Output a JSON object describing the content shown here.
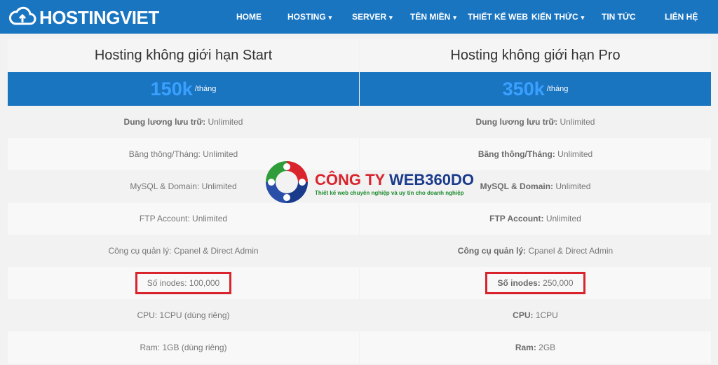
{
  "brand": {
    "name": "HOSTINGVIET"
  },
  "nav": {
    "items": [
      {
        "label": "HOME",
        "dropdown": false
      },
      {
        "label": "HOSTING",
        "dropdown": true
      },
      {
        "label": "SERVER",
        "dropdown": true
      },
      {
        "label": "TÊN MIỀN",
        "dropdown": true
      },
      {
        "label": "THIẾT KẾ WEB",
        "dropdown": false
      },
      {
        "label": "KIẾN THỨC",
        "dropdown": true
      },
      {
        "label": "TIN TỨC",
        "dropdown": false
      },
      {
        "label": "LIÊN HỆ",
        "dropdown": false
      }
    ],
    "caret": "▾"
  },
  "plans": [
    {
      "title": "Hosting không giới hạn Start",
      "price": "150k",
      "per": "/tháng",
      "features": [
        {
          "label": "Dung lương lưu trữ:",
          "value": " Unlimited",
          "bold": true
        },
        {
          "label": "Băng thông/Tháng:",
          "value": " Unlimited",
          "bold": false
        },
        {
          "label": "MySQL & Domain:",
          "value": " Unlimited",
          "bold": false
        },
        {
          "label": "FTP Account:",
          "value": " Unlimited",
          "bold": false
        },
        {
          "label": "Công cụ quản lý:",
          "value": " Cpanel & Direct Admin",
          "bold": false
        },
        {
          "label": "Số inodes:",
          "value": " 100,000",
          "bold": false
        },
        {
          "label": "CPU:",
          "value": " 1CPU (dùng riêng)",
          "bold": false
        },
        {
          "label": "Ram:",
          "value": " 1GB (dùng riêng)",
          "bold": false
        }
      ]
    },
    {
      "title": "Hosting không giới hạn Pro",
      "price": "350k",
      "per": "/tháng",
      "features": [
        {
          "label": "Dung lương lưu trữ:",
          "value": " Unlimited",
          "bold": true
        },
        {
          "label": "Băng thông/Tháng:",
          "value": " Unlimited",
          "bold": true
        },
        {
          "label": "MySQL & Domain:",
          "value": " Unlimited",
          "bold": true
        },
        {
          "label": "FTP Account:",
          "value": " Unlimited",
          "bold": true
        },
        {
          "label": "Công cụ quản lý:",
          "value": " Cpanel & Direct Admin",
          "bold": true
        },
        {
          "label": "Số inodes:",
          "value": " 250,000",
          "bold": true
        },
        {
          "label": "CPU:",
          "value": " 1CPU",
          "bold": true
        },
        {
          "label": "Ram:",
          "value": " 2GB",
          "bold": true
        }
      ]
    }
  ],
  "watermark": {
    "title_red": "CÔNG TY ",
    "title_blue": "WEB360DO",
    "subtitle": "Thiết kế web chuyên nghiệp và uy tín cho doanh nghiệp"
  },
  "colors": {
    "nav_bg": "#1a75c1",
    "price_text": "#3aa0ff",
    "highlight_border": "#d9232d"
  }
}
